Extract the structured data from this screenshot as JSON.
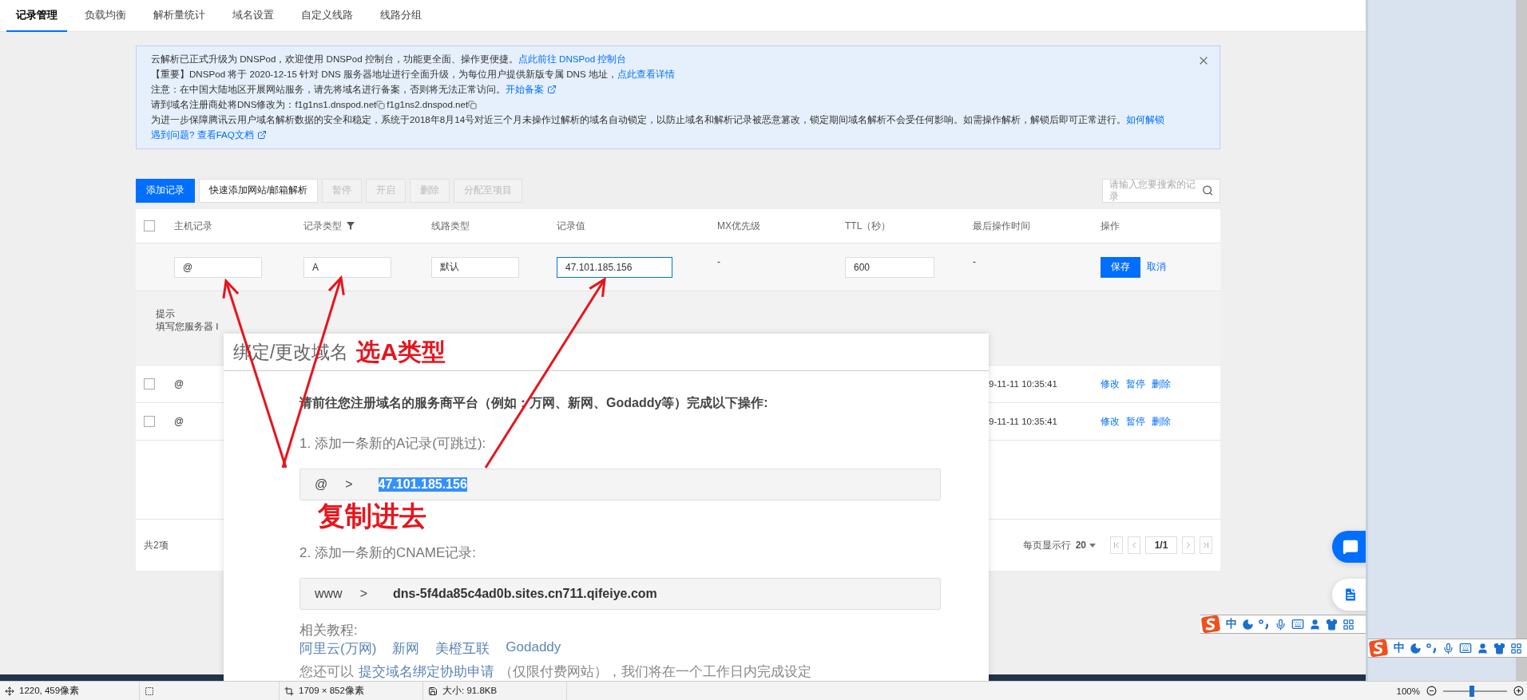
{
  "tabs": [
    {
      "label": "记录管理",
      "selected": true
    },
    {
      "label": "负载均衡",
      "selected": false
    },
    {
      "label": "解析量统计",
      "selected": false
    },
    {
      "label": "域名设置",
      "selected": false
    },
    {
      "label": "自定义线路",
      "selected": false
    },
    {
      "label": "线路分组",
      "selected": false
    }
  ],
  "notice": {
    "lines": [
      {
        "segments": [
          {
            "kind": "text",
            "text": "云解析已正式升级为 DNSPod，欢迎使用 DNSPod 控制台，功能更全面、操作更便捷。"
          },
          {
            "kind": "link",
            "text": "点此前往 DNSPod 控制台"
          }
        ]
      },
      {
        "segments": [
          {
            "kind": "text",
            "text": "【重要】DNSPod 将于 2020-12-15 针对 DNS 服务器地址进行全面升级，为每位用户提供新版专属 DNS 地址，"
          },
          {
            "kind": "link",
            "text": "点此查看详情"
          }
        ]
      },
      {
        "segments": [
          {
            "kind": "text",
            "text": "注意：在中国大陆地区开展网站服务，请先将域名进行备案，否则将无法正常访问。"
          },
          {
            "kind": "link",
            "text": "开始备案"
          },
          {
            "kind": "external-icon"
          }
        ]
      },
      {
        "segments": [
          {
            "kind": "text",
            "text": "请到域名注册商处将DNS修改为：f1g1ns1.dnspod.net"
          },
          {
            "kind": "copy-icon"
          },
          {
            "kind": "text",
            "text": "f1g1ns2.dnspod.net"
          },
          {
            "kind": "copy-icon"
          }
        ]
      },
      {
        "segments": [
          {
            "kind": "text",
            "text": "为进一步保障腾讯云用户域名解析数据的安全和稳定，系统于2018年8月14号对近三个月未操作过解析的域名自动锁定，以防止域名和解析记录被恶意篡改，锁定期间域名解析不会受任何影响。如需操作解析，解锁后即可正常进行。"
          },
          {
            "kind": "link",
            "text": "如何解锁"
          }
        ]
      },
      {
        "segments": [
          {
            "kind": "link",
            "text": "遇到问题? 查看FAQ文档"
          },
          {
            "kind": "external-icon"
          }
        ]
      }
    ]
  },
  "toolbar": {
    "buttons": [
      {
        "label": "添加记录",
        "kind": "primary",
        "disabled": false
      },
      {
        "label": "快速添加网站/邮箱解析",
        "kind": "default",
        "disabled": false
      },
      {
        "label": "暂停",
        "kind": "default",
        "disabled": true
      },
      {
        "label": "开启",
        "kind": "default",
        "disabled": true
      },
      {
        "label": "删除",
        "kind": "default",
        "disabled": true
      },
      {
        "label": "分配至项目",
        "kind": "default",
        "disabled": true
      }
    ],
    "search": {
      "placeholder": "请输入您要搜索的记录"
    }
  },
  "table": {
    "select_all": {
      "checked": false
    },
    "columns": [
      {
        "label": "主机记录",
        "kind": "plain"
      },
      {
        "label": "记录类型",
        "kind": "filter"
      },
      {
        "label": "线路类型",
        "kind": "plain"
      },
      {
        "label": "记录值",
        "kind": "plain"
      },
      {
        "label": "MX优先级",
        "kind": "plain"
      },
      {
        "label": "TTL（秒）",
        "kind": "plain"
      },
      {
        "label": "最后操作时间",
        "kind": "plain"
      },
      {
        "label": "操作",
        "kind": "plain"
      }
    ],
    "edit_row": {
      "cells": [
        {
          "kind": "input",
          "value": "@",
          "focused": false
        },
        {
          "kind": "input",
          "value": "A",
          "focused": false
        },
        {
          "kind": "input",
          "value": "默认",
          "focused": false
        },
        {
          "kind": "input",
          "value": "47.101.185.156",
          "focused": true
        },
        {
          "kind": "text",
          "value": "-"
        },
        {
          "kind": "input",
          "value": "600",
          "focused": false
        },
        {
          "kind": "text",
          "value": "-"
        }
      ],
      "save": "保存",
      "cancel": "取消"
    },
    "tip": {
      "title": "提示",
      "text": "填写您服务器 I"
    },
    "rows": [
      {
        "checked": false,
        "host": "@",
        "time": "9-11-11 10:35:41",
        "actions": [
          "修改",
          "暂停",
          "删除"
        ]
      },
      {
        "checked": false,
        "host": "@",
        "time": "9-11-11 10:35:41",
        "actions": [
          "修改",
          "暂停",
          "删除"
        ]
      }
    ],
    "footer": {
      "total": "共2项",
      "page_size_label": "每页显示行",
      "page_size": "20",
      "page": "1/1"
    }
  },
  "dialog": {
    "title": "绑定/更改域名",
    "instruction": "请前往您注册域名的服务商平台（例如：万网、新网、Godaddy等）完成以下操作:",
    "steps": [
      {
        "label": "1. 添加一条新的A记录(可跳过):",
        "host": "@",
        "arrow": ">",
        "value": "47.101.185.156",
        "selected": true
      },
      {
        "label": "2. 添加一条新的CNAME记录:",
        "host": "www",
        "arrow": ">",
        "value": "dns-5f4da85c4ad0b.sites.cn711.qifeiye.com",
        "selected": false
      }
    ],
    "tutorial_label": "相关教程:",
    "tutorial_links": [
      "阿里云(万网)",
      "新网",
      "美橙互联",
      "Godaddy"
    ],
    "footer": {
      "before": "您还可以",
      "link": "提交域名绑定协助申请",
      "after": "（仅限付费网站），我们将在一个工作日内完成设定"
    }
  },
  "annotations": {
    "title_note": "选A类型",
    "copy_note": "复制进去"
  },
  "ime_bars": [
    {
      "mode": "中"
    },
    {
      "mode": "中"
    }
  ],
  "status_bar": {
    "cursor": "1220, 459像素",
    "image_size": "1709 × 852像素",
    "file_size": "大小: 91.8KB",
    "zoom": "100%",
    "zoom_slider": {
      "level": 0.45
    }
  }
}
